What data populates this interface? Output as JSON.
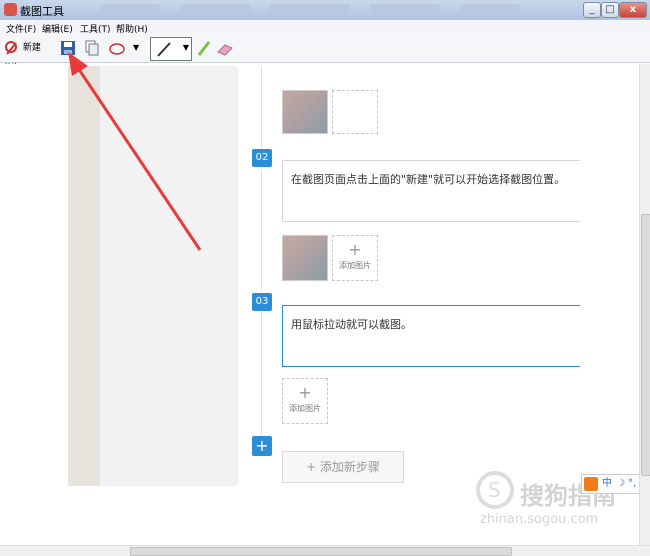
{
  "window": {
    "title": "截图工具",
    "buttons": [
      "_",
      "□",
      "x"
    ]
  },
  "menu": [
    "文件(F)",
    "编辑(E)",
    "工具(T)",
    "帮助(H)"
  ],
  "toolbar": {
    "new_label": "新建(N)"
  },
  "steps": [
    {
      "num": "02",
      "text": "在截图页面点击上面的\"新建\"就可以开始选择截图位置。"
    },
    {
      "num": "03",
      "text": "用鼠标拉动就可以截图。"
    }
  ],
  "add_image_label": "添加图片",
  "add_step_label": "+ 添加新步骤",
  "ime": {
    "text": "中"
  },
  "watermark": {
    "brand": "搜狗指南",
    "url": "zhinan.sogou.com"
  },
  "colors": {
    "accent": "#2b8ed6",
    "arrow": "#e8393b"
  }
}
